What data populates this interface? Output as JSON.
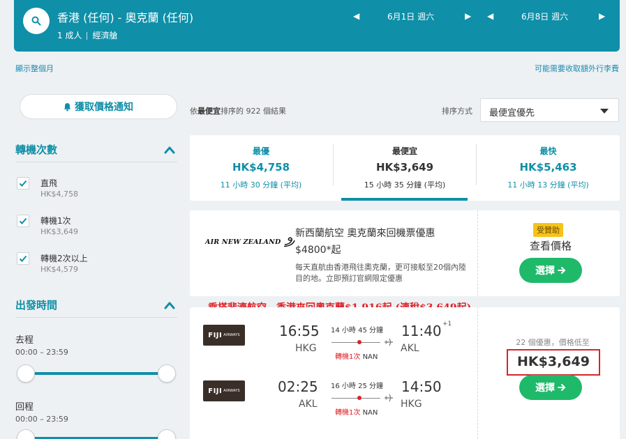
{
  "search": {
    "route": "香港 (任何) - 奧克蘭 (任何)",
    "passengers": "1 成人",
    "cabin": "經濟艙",
    "depart_date": "6月1日 週六",
    "return_date": "6月8日 週六"
  },
  "links": {
    "show_month": "顯示整個月",
    "extra_fees": "可能需要收取額外行李費"
  },
  "sidebar": {
    "alert_label": "獲取價格通知",
    "stops_title": "轉機次數",
    "stops": [
      {
        "label": "直飛",
        "price": "HK$4,758"
      },
      {
        "label": "轉機1次",
        "price": "HK$3,649"
      },
      {
        "label": "轉機2次以上",
        "price": "HK$4,579"
      }
    ],
    "times_title": "出發時間",
    "outbound_label": "去程",
    "outbound_range": "00:00 – 23:59",
    "return_label": "回程",
    "return_range": "00:00 – 23:59"
  },
  "results": {
    "count_prefix": "依",
    "count_bold": "最便宜",
    "count_suffix": "排序的 922 個結果",
    "sort_label": "排序方式",
    "sort_value": "最便宜優先"
  },
  "summary": [
    {
      "label": "最優",
      "price": "HK$4,758",
      "duration": "11 小時 30 分鐘 (平均)"
    },
    {
      "label": "最便宜",
      "price": "HK$3,649",
      "duration": "15 小時 35 分鐘 (平均)"
    },
    {
      "label": "最快",
      "price": "HK$5,463",
      "duration": "11 小時 13 分鐘 (平均)"
    }
  ],
  "ad": {
    "logo_text": "AIR NEW ZEALAND",
    "title": "新西蘭航空 奧克蘭來回機票優惠",
    "price": "$4800*起",
    "desc": "每天直航由香港飛往奧克蘭，更可接駁至20個內陸目的地。立即預訂官網限定優惠",
    "badge": "受贊助",
    "check_price": "查看價格",
    "select_label": "選擇"
  },
  "annotation": "乘搭斐濟航空，香港來回奧克蘭$1,916起 (連稅$3,649起)",
  "flight": {
    "airline_logo": "FIJI",
    "airline_sub": "AIRWAYS",
    "legs": [
      {
        "dep_time": "16:55",
        "dep_code": "HKG",
        "duration": "14 小時 45 分鐘",
        "stops": "轉機1次",
        "via": "NAN",
        "arr_time": "11:40",
        "day_offset": "+1",
        "arr_code": "AKL"
      },
      {
        "dep_time": "02:25",
        "dep_code": "AKL",
        "duration": "16 小時 25 分鐘",
        "stops": "轉機1次",
        "via": "NAN",
        "arr_time": "14:50",
        "day_offset": "",
        "arr_code": "HKG"
      }
    ],
    "deals": "22 個優惠，價格低至",
    "price": "HK$3,649",
    "select_label": "選擇"
  }
}
